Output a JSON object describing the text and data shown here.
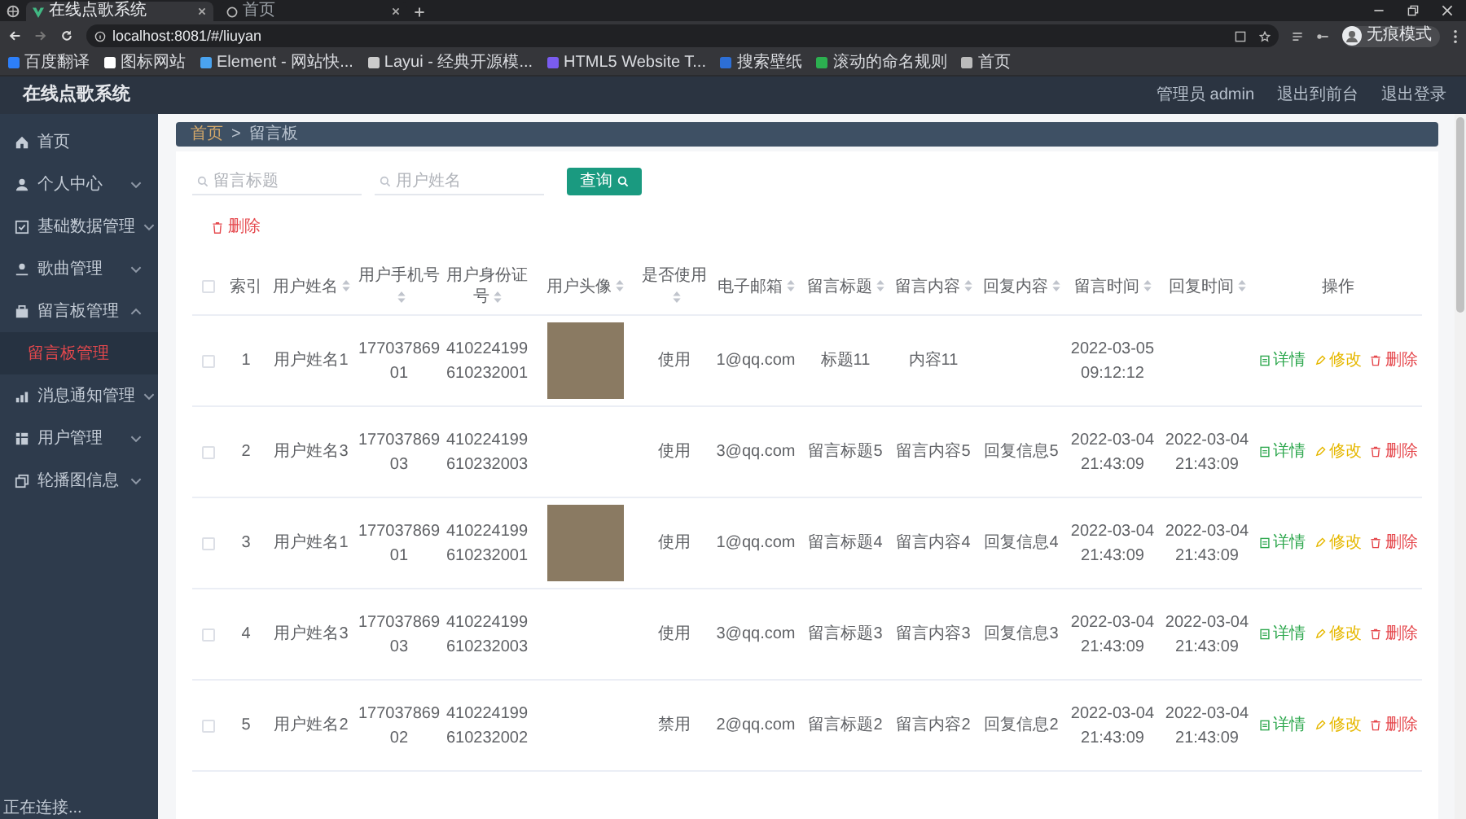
{
  "browser": {
    "tabs": [
      {
        "title": "在线点歌系统",
        "selected": true
      },
      {
        "title": "首页",
        "selected": false
      }
    ],
    "address": "localhost:8081/#/liuyan",
    "bookmarks": [
      "百度翻译",
      "图标网站",
      "Element - 网站快...",
      "Layui - 经典开源模...",
      "HTML5 Website T...",
      "搜索壁纸",
      "滚动的命名规则",
      "首页"
    ],
    "profile": "无痕模式"
  },
  "app": {
    "title": "在线点歌系统",
    "user": "管理员 admin",
    "links": [
      "退出到前台",
      "退出登录"
    ]
  },
  "sidebar": {
    "items": [
      {
        "label": "首页",
        "kind": "link"
      },
      {
        "label": "个人中心",
        "kind": "menu",
        "expanded": false
      },
      {
        "label": "基础数据管理",
        "kind": "menu",
        "expanded": false
      },
      {
        "label": "歌曲管理",
        "kind": "menu",
        "expanded": false
      },
      {
        "label": "留言板管理",
        "kind": "menu",
        "expanded": true,
        "children": [
          {
            "label": "留言板管理",
            "selected": true
          }
        ]
      },
      {
        "label": "消息通知管理",
        "kind": "menu",
        "expanded": false
      },
      {
        "label": "用户管理",
        "kind": "menu",
        "expanded": false
      },
      {
        "label": "轮播图信息",
        "kind": "menu",
        "expanded": false
      }
    ]
  },
  "breadcrumb": [
    "首页",
    ">",
    "留言板"
  ],
  "search": {
    "fields": [
      {
        "placeholder": "留言标题"
      },
      {
        "placeholder": "用户姓名"
      }
    ],
    "button": "查询"
  },
  "toolbar": {
    "delete": "删除"
  },
  "table": {
    "select_all_checked": false,
    "columns": [
      {
        "label": "索引",
        "sortable": false
      },
      {
        "label": "用户姓名",
        "sortable": true
      },
      {
        "label": "用户手机号",
        "sortable": true
      },
      {
        "label": "用户身份证号",
        "sortable": true
      },
      {
        "label": "用户头像",
        "sortable": true
      },
      {
        "label": "是否使用",
        "sortable": true
      },
      {
        "label": "电子邮箱",
        "sortable": true
      },
      {
        "label": "留言标题",
        "sortable": true
      },
      {
        "label": "留言内容",
        "sortable": true
      },
      {
        "label": "回复内容",
        "sortable": true
      },
      {
        "label": "留言时间",
        "sortable": true
      },
      {
        "label": "回复时间",
        "sortable": true
      },
      {
        "label": "操作",
        "sortable": false
      }
    ],
    "rows": [
      {
        "checked": false,
        "index": "1",
        "name": "用户姓名1",
        "phone": "17703786901",
        "id_card": "410224199610232001",
        "avatar": true,
        "use": "使用",
        "email": "1@qq.com",
        "title": "标题11",
        "content": "内容11",
        "reply": "",
        "time": "2022-03-05 09:12:12",
        "reply_time": "",
        "actions": [
          {
            "kind": "detail",
            "label": "详情"
          },
          {
            "kind": "edit",
            "label": "修改"
          },
          {
            "kind": "delete",
            "label": "删除"
          }
        ]
      },
      {
        "checked": false,
        "index": "2",
        "name": "用户姓名3",
        "phone": "17703786903",
        "id_card": "410224199610232003",
        "avatar": false,
        "use": "使用",
        "email": "3@qq.com",
        "title": "留言标题5",
        "content": "留言内容5",
        "reply": "回复信息5",
        "time": "2022-03-04 21:43:09",
        "reply_time": "2022-03-04 21:43:09",
        "actions": [
          {
            "kind": "detail",
            "label": "详情"
          },
          {
            "kind": "edit",
            "label": "修改"
          },
          {
            "kind": "delete",
            "label": "删除"
          }
        ]
      },
      {
        "checked": false,
        "index": "3",
        "name": "用户姓名1",
        "phone": "17703786901",
        "id_card": "410224199610232001",
        "avatar": true,
        "use": "使用",
        "email": "1@qq.com",
        "title": "留言标题4",
        "content": "留言内容4",
        "reply": "回复信息4",
        "time": "2022-03-04 21:43:09",
        "reply_time": "2022-03-04 21:43:09",
        "actions": [
          {
            "kind": "detail",
            "label": "详情"
          },
          {
            "kind": "edit",
            "label": "修改"
          },
          {
            "kind": "delete",
            "label": "删除"
          }
        ]
      },
      {
        "checked": false,
        "index": "4",
        "name": "用户姓名3",
        "phone": "17703786903",
        "id_card": "410224199610232003",
        "avatar": false,
        "use": "使用",
        "email": "3@qq.com",
        "title": "留言标题3",
        "content": "留言内容3",
        "reply": "回复信息3",
        "time": "2022-03-04 21:43:09",
        "reply_time": "2022-03-04 21:43:09",
        "actions": [
          {
            "kind": "detail",
            "label": "详情"
          },
          {
            "kind": "edit",
            "label": "修改"
          },
          {
            "kind": "delete",
            "label": "删除"
          }
        ]
      },
      {
        "checked": false,
        "index": "5",
        "name": "用户姓名2",
        "phone": "17703786902",
        "id_card": "410224199610232002",
        "avatar": false,
        "use": "禁用",
        "email": "2@qq.com",
        "title": "留言标题2",
        "content": "留言内容2",
        "reply": "回复信息2",
        "time": "2022-03-04 21:43:09",
        "reply_time": "2022-03-04 21:43:09",
        "actions": [
          {
            "kind": "detail",
            "label": "详情"
          },
          {
            "kind": "edit",
            "label": "修改"
          },
          {
            "kind": "delete",
            "label": "删除"
          }
        ]
      }
    ]
  },
  "status_bar": "正在连接..."
}
